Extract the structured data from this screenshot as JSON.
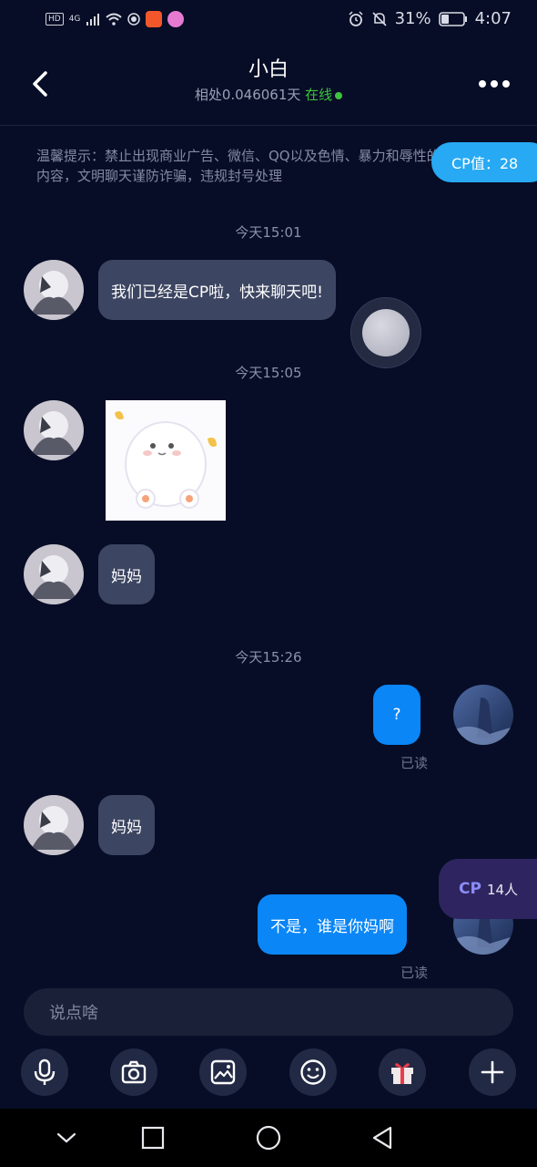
{
  "status_bar": {
    "hd": "HD",
    "net": "4G",
    "battery": "31%",
    "time": "4:07"
  },
  "header": {
    "title": "小白",
    "subtitle_prefix": "相处0.046061天",
    "online": "在线"
  },
  "notice": "温馨提示：禁止出现商业广告、微信、QQ以及色情、暴力和辱性的内容，文明聊天谨防诈骗，违规封号处理",
  "cp_value": "CP值：28",
  "messages": {
    "t1": "今天15:01",
    "m1": "我们已经是CP啦，快来聊天吧!",
    "t2": "今天15:05",
    "m3": "妈妈",
    "t3": "今天15:26",
    "m4": "?",
    "m4_read": "已读",
    "m5": "妈妈",
    "m6": "不是，谁是你妈啊",
    "m6_read": "已读"
  },
  "cp_tab": {
    "label": "CP",
    "count": "14人"
  },
  "input": {
    "placeholder": "说点啥"
  },
  "icons": {
    "back": "chevron-left-icon",
    "more": "more-icon",
    "mic": "microphone-icon",
    "camera": "camera-icon",
    "image": "image-icon",
    "emoji": "emoji-icon",
    "gift": "gift-icon",
    "plus": "plus-icon"
  },
  "colors": {
    "background": "#070d26",
    "outgoing_bubble": "#0a86f7",
    "incoming_bubble": "#3c4561",
    "cp_pill": "#27a9f3",
    "online": "#3fc23f"
  }
}
